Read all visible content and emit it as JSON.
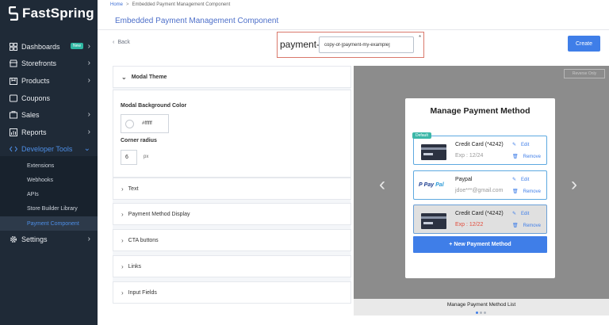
{
  "brand": {
    "name": "FastSpring"
  },
  "sidebar": {
    "items": [
      {
        "label": "Dashboards",
        "icon": "grid-icon",
        "badge": "New"
      },
      {
        "label": "Storefronts",
        "icon": "storefront-icon"
      },
      {
        "label": "Products",
        "icon": "box-icon"
      },
      {
        "label": "Coupons",
        "icon": "coupon-icon"
      },
      {
        "label": "Sales",
        "icon": "cart-icon"
      },
      {
        "label": "Reports",
        "icon": "chart-icon"
      },
      {
        "label": "Developer Tools",
        "icon": "code-icon"
      },
      {
        "label": "Settings",
        "icon": "gear-icon"
      }
    ],
    "sub_items": [
      {
        "label": "Extensions"
      },
      {
        "label": "Webhooks"
      },
      {
        "label": "APIs"
      },
      {
        "label": "Store Builder Library"
      },
      {
        "label": "Payment Component"
      }
    ]
  },
  "breadcrumb": {
    "home": "Home",
    "separator": ">",
    "current": "Embedded Payment Management Component"
  },
  "page": {
    "title": "Embedded Payment Management Component",
    "back_label": "Back"
  },
  "name_field": {
    "prefix": "payment-",
    "value": "copy-of-[payment-my-example]",
    "required_mark": "*"
  },
  "toolbar": {
    "create_label": "Create"
  },
  "config": {
    "modal_theme": {
      "title": "Modal Theme",
      "bg_label": "Modal Background Color",
      "bg_value": "#ffffff",
      "radius_label": "Corner radius",
      "radius_value": "6",
      "radius_unit": "px"
    },
    "sections": [
      {
        "title": "Text"
      },
      {
        "title": "Payment Method Display"
      },
      {
        "title": "CTA buttons"
      },
      {
        "title": "Links"
      },
      {
        "title": "Input Fields"
      }
    ]
  },
  "preview": {
    "reverse_label": "Reverse Only",
    "card_title": "Manage Payment Method",
    "default_tag": "Default",
    "methods": [
      {
        "name": "Credit Card (*4242)",
        "sub": "Exp : 12/24",
        "edit": "Edit",
        "remove": "Remove"
      },
      {
        "name": "Paypal",
        "sub": "jdoe***@gmail.com",
        "edit": "Edit",
        "remove": "Remove",
        "logo_a": "Pay",
        "logo_b": "Pal"
      },
      {
        "name": "Credit Card (*4242)",
        "sub": "Exp : 12/22",
        "edit": "Edit",
        "remove": "Remove"
      }
    ],
    "new_button": "+ New Payment Method",
    "caption": "Manage Payment Method List",
    "carousel": {
      "count": 3,
      "active": 1
    }
  },
  "colors": {
    "accent": "#3f7ee8",
    "sidebar": "#1f2a37",
    "highlight_border": "#d9786b",
    "badge": "#2fb7a3",
    "expired": "#e24b3b"
  }
}
